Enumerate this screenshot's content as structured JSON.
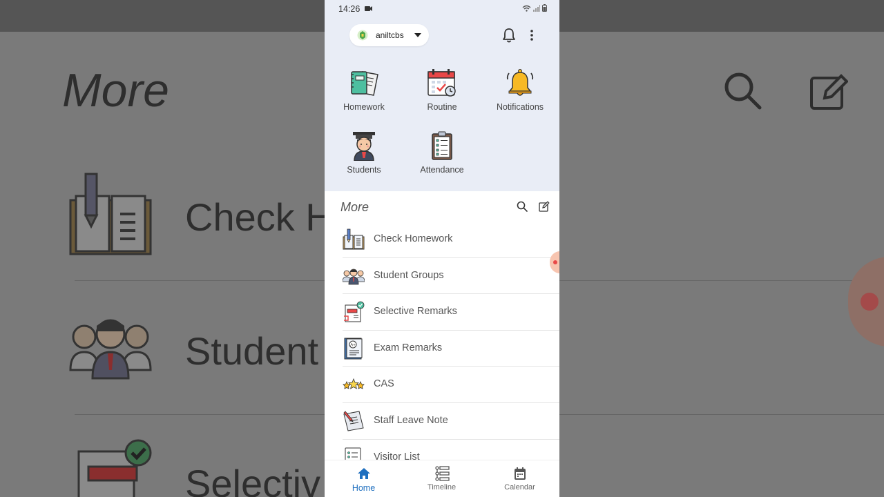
{
  "status_bar": {
    "time": "14:26"
  },
  "header": {
    "school_name": "aniltcbs"
  },
  "quick_actions": [
    {
      "label": "Homework",
      "icon": "homework-notebook-icon"
    },
    {
      "label": "Routine",
      "icon": "routine-calendar-icon"
    },
    {
      "label": "Notifications",
      "icon": "notifications-bell-icon"
    },
    {
      "label": "Students",
      "icon": "student-graduate-icon"
    },
    {
      "label": "Attendance",
      "icon": "attendance-clipboard-icon"
    }
  ],
  "more_section": {
    "title": "More",
    "items": [
      {
        "label": "Check Homework",
        "icon": "check-homework-book-icon"
      },
      {
        "label": "Student Groups",
        "icon": "student-groups-icon"
      },
      {
        "label": "Selective Remarks",
        "icon": "selective-remarks-icon"
      },
      {
        "label": "Exam Remarks",
        "icon": "exam-remarks-icon"
      },
      {
        "label": "CAS",
        "icon": "cas-stars-icon"
      },
      {
        "label": "Staff Leave Note",
        "icon": "staff-leave-note-icon"
      },
      {
        "label": "Visitor List",
        "icon": "visitor-list-icon"
      }
    ]
  },
  "bottom_nav": [
    {
      "label": "Home",
      "icon": "home-icon",
      "active": true
    },
    {
      "label": "Timeline",
      "icon": "timeline-icon",
      "active": false
    },
    {
      "label": "Calendar",
      "icon": "calendar-icon",
      "active": false
    }
  ],
  "background": {
    "title": "More",
    "rows": [
      "Check H",
      "Student",
      "Selectiv"
    ]
  },
  "colors": {
    "accent": "#1f6fbf",
    "top_bg": "#e9edf6",
    "background_dim": "#7a7a7a"
  }
}
